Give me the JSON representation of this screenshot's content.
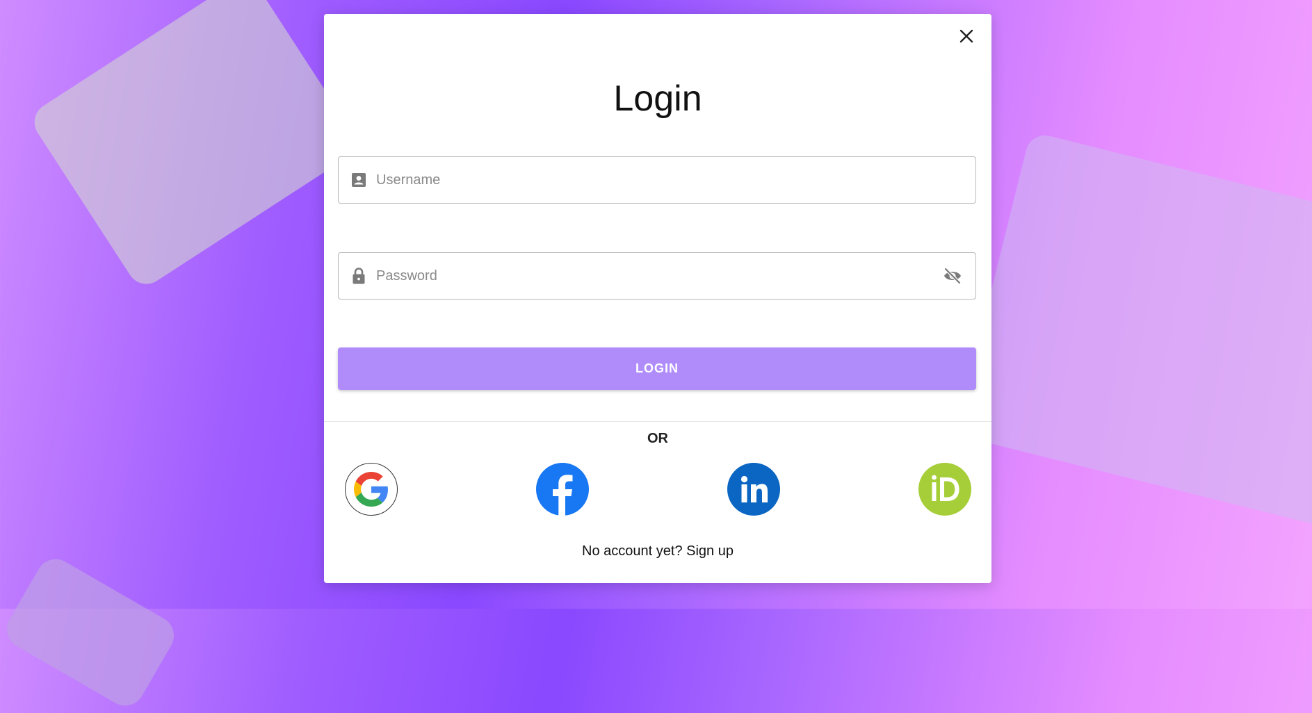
{
  "modal": {
    "title": "Login",
    "close_icon": "close-icon"
  },
  "username": {
    "placeholder": "Username",
    "value": "",
    "icon": "account-box-icon"
  },
  "password": {
    "placeholder": "Password",
    "value": "",
    "icon": "lock-icon",
    "toggle_icon": "eye-off-icon"
  },
  "login_button": {
    "label": "LOGIN",
    "color": "#b08cfb"
  },
  "divider": {
    "label": "OR"
  },
  "social": [
    {
      "name": "google",
      "icon": "google-icon"
    },
    {
      "name": "facebook",
      "icon": "facebook-icon",
      "color": "#1877f2"
    },
    {
      "name": "linkedin",
      "icon": "linkedin-icon",
      "color": "#0a66c2"
    },
    {
      "name": "orcid",
      "icon": "orcid-icon",
      "color": "#a6ce39"
    }
  ],
  "signup": {
    "prompt": "No account yet?",
    "link": "Sign up"
  }
}
